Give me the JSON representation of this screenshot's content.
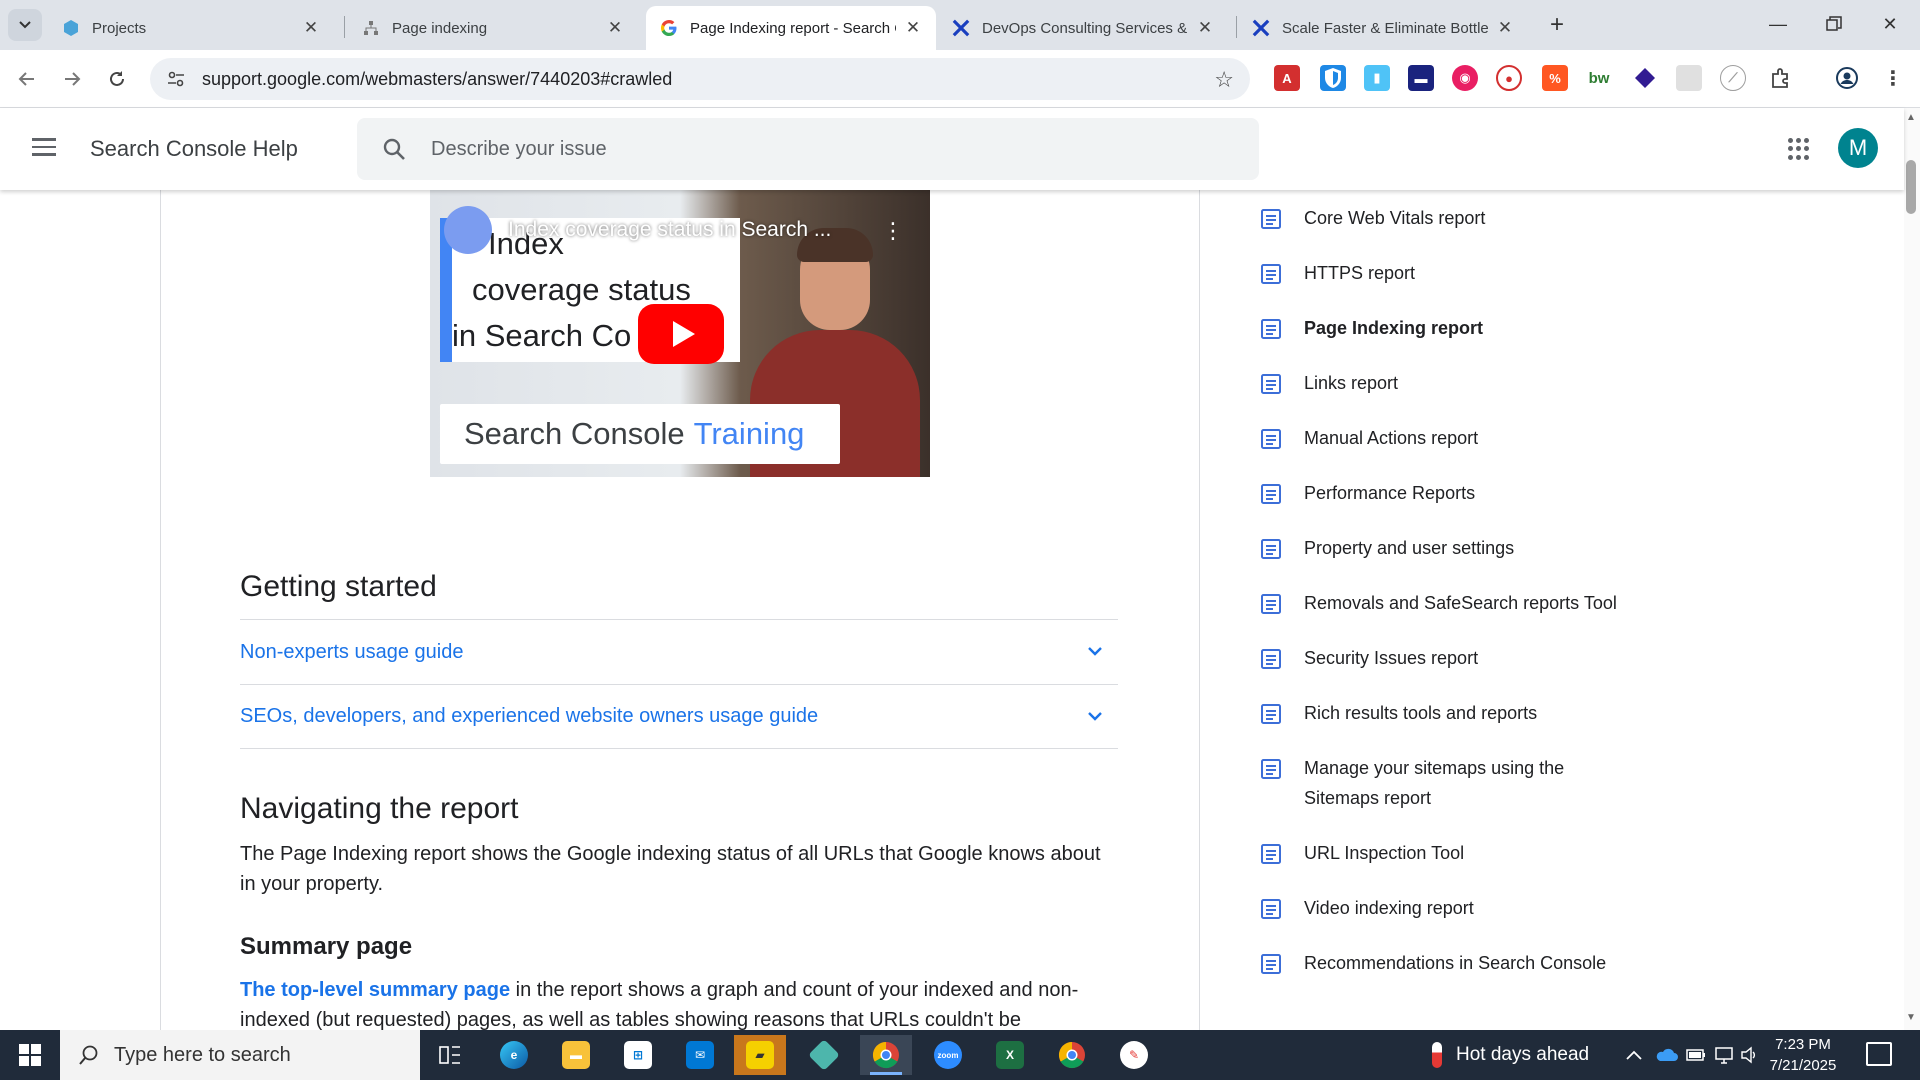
{
  "browser": {
    "tabs": [
      {
        "title": "Projects",
        "favicon": "projects-hexagon-icon",
        "active": false
      },
      {
        "title": "Page indexing",
        "favicon": "sitemap-icon",
        "active": false
      },
      {
        "title": "Page Indexing report - Search C",
        "favicon": "google-g-icon",
        "active": true
      },
      {
        "title": "DevOps Consulting Services & S",
        "favicon": "x-logo-icon",
        "active": false
      },
      {
        "title": "Scale Faster & Eliminate Bottlen",
        "favicon": "x-logo-icon",
        "active": false
      }
    ],
    "url": "support.google.com/webmasters/answer/7440203#crawled"
  },
  "header": {
    "title": "Search Console Help",
    "search_placeholder": "Describe your issue",
    "avatar_letter": "M"
  },
  "video": {
    "overlay_title": "Index coverage status in Search ...",
    "card_lines": [
      "Index",
      "coverage status",
      "in Search Co"
    ],
    "brand_prefix": "Search Console",
    "brand_suffix": "Training"
  },
  "article": {
    "getting_started": "Getting started",
    "expanders": [
      "Non-experts usage guide",
      "SEOs, developers, and experienced website owners usage guide"
    ],
    "navigating": "Navigating the report",
    "navigating_text": "The Page Indexing report shows the Google indexing status of all URLs that Google knows about in your property.",
    "summary_heading": "Summary page",
    "summary_link": "The top-level summary page",
    "summary_text": " in the report shows a graph and count of your indexed and non-indexed (but requested) pages, as well as tables showing reasons that URLs couldn't be"
  },
  "sidebar": {
    "items": [
      {
        "label": "Core Web Vitals report"
      },
      {
        "label": "HTTPS report"
      },
      {
        "label": "Page Indexing report",
        "current": true
      },
      {
        "label": "Links report"
      },
      {
        "label": "Manual Actions report"
      },
      {
        "label": "Performance Reports"
      },
      {
        "label": "Property and user settings"
      },
      {
        "label": "Removals and SafeSearch reports Tool"
      },
      {
        "label": "Security Issues report"
      },
      {
        "label": "Rich results tools and reports"
      },
      {
        "label": "Manage your sitemaps using the Sitemaps report"
      },
      {
        "label": "URL Inspection Tool"
      },
      {
        "label": "Video indexing report"
      },
      {
        "label": "Recommendations in Search Console"
      }
    ]
  },
  "taskbar": {
    "search_placeholder": "Type here to search",
    "weather": "Hot days ahead",
    "time": "7:23 PM",
    "date": "7/21/2025"
  },
  "colors": {
    "accent": "#1a73e8",
    "youtube_red": "#ff0000",
    "avatar": "#00838f"
  }
}
